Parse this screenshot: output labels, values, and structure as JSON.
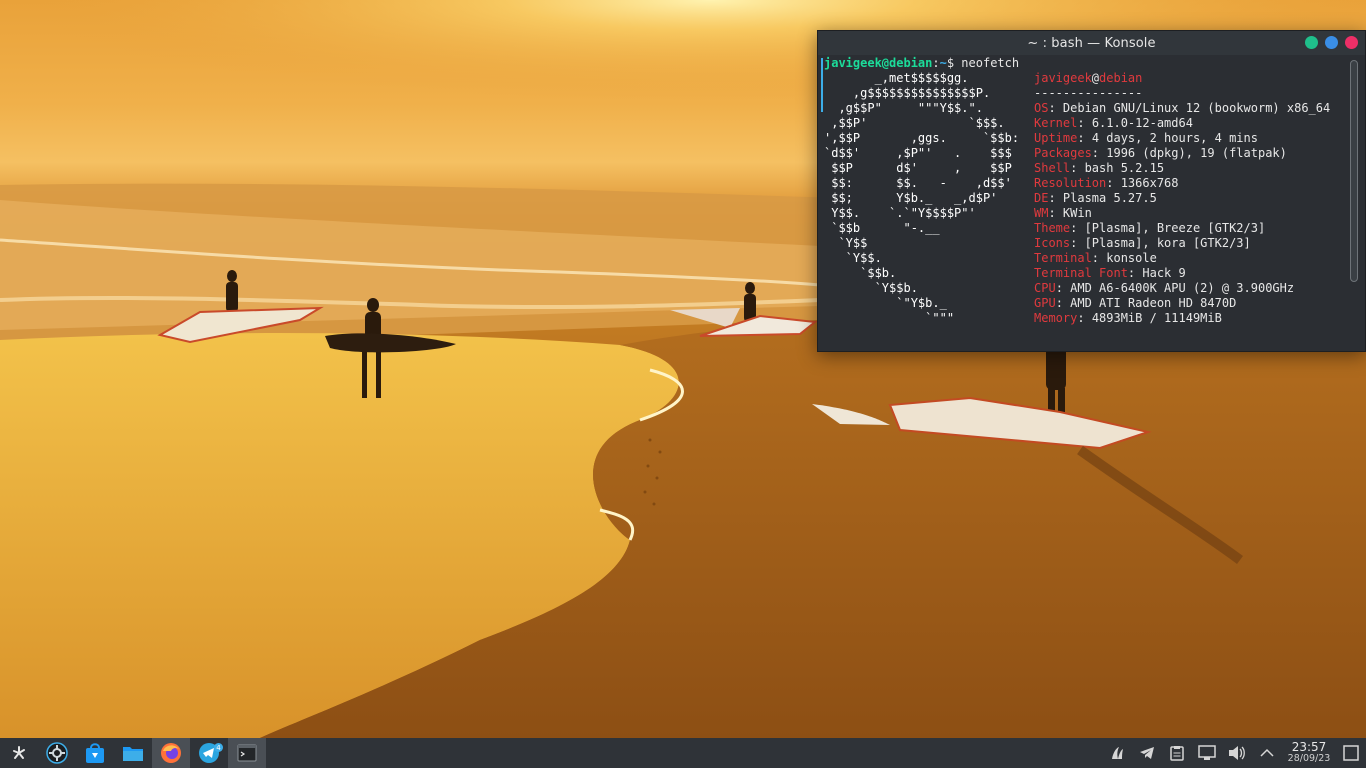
{
  "window": {
    "title": "~ : bash — Konsole"
  },
  "terminal": {
    "prompt_user": "javigeek@debian",
    "prompt_sep": ":",
    "prompt_path": "~",
    "prompt_dollar": "$ ",
    "command": "neofetch",
    "ascii_lines": [
      "       _,met$$$$$gg.",
      "    ,g$$$$$$$$$$$$$$$P.",
      "  ,g$$P\"     \"\"\"Y$$.\".",
      " ,$$P'              `$$$.",
      "',$$P       ,ggs.     `$$b:",
      "`d$$'     ,$P\"'   .    $$$",
      " $$P      d$'     ,    $$P",
      " $$:      $$.   -    ,d$$'",
      " $$;      Y$b._   _,d$P'",
      " Y$$.    `.`\"Y$$$$P\"'",
      " `$$b      \"-.__",
      "  `Y$$",
      "   `Y$$.",
      "     `$$b.",
      "       `Y$$b.",
      "          `\"Y$b._",
      "              `\"\"\""
    ],
    "header_user": "javigeek",
    "header_at": "@",
    "header_host": "debian",
    "separator": "---------------",
    "info": [
      {
        "key": "OS",
        "value": "Debian GNU/Linux 12 (bookworm) x86_64"
      },
      {
        "key": "Kernel",
        "value": "6.1.0-12-amd64"
      },
      {
        "key": "Uptime",
        "value": "4 days, 2 hours, 4 mins"
      },
      {
        "key": "Packages",
        "value": "1996 (dpkg), 19 (flatpak)"
      },
      {
        "key": "Shell",
        "value": "bash 5.2.15"
      },
      {
        "key": "Resolution",
        "value": "1366x768"
      },
      {
        "key": "DE",
        "value": "Plasma 5.27.5"
      },
      {
        "key": "WM",
        "value": "KWin"
      },
      {
        "key": "Theme",
        "value": "[Plasma], Breeze [GTK2/3]"
      },
      {
        "key": "Icons",
        "value": "[Plasma], kora [GTK2/3]"
      },
      {
        "key": "Terminal",
        "value": "konsole"
      },
      {
        "key": "Terminal Font",
        "value": "Hack 9"
      },
      {
        "key": "CPU",
        "value": "AMD A6-6400K APU (2) @ 3.900GHz"
      },
      {
        "key": "GPU",
        "value": "AMD ATI Radeon HD 8470D"
      },
      {
        "key": "Memory",
        "value": "4893MiB / 11149MiB"
      }
    ]
  },
  "taskbar": {
    "launchers": [
      {
        "name": "application-launcher",
        "icon": "kde-launcher-icon"
      },
      {
        "name": "system-settings",
        "icon": "settings-wheel-icon"
      },
      {
        "name": "discover",
        "icon": "discover-bag-icon"
      },
      {
        "name": "dolphin",
        "icon": "folder-icon"
      },
      {
        "name": "firefox",
        "icon": "firefox-icon"
      },
      {
        "name": "telegram",
        "icon": "telegram-icon",
        "badge": "4"
      },
      {
        "name": "konsole",
        "icon": "terminal-icon"
      }
    ],
    "tray": [
      "kdeconnect-icon",
      "telegram-tray-icon",
      "clipboard-icon",
      "network-icon",
      "volume-icon",
      "chevron-up-icon"
    ],
    "clock": {
      "time": "23:57",
      "date": "28/09/23"
    },
    "show_desktop_icon": "show-desktop-icon"
  },
  "colors": {
    "accent": "#3daee9",
    "prompt_user": "#1cdc9a",
    "debian_red": "#e03a3e",
    "panel": "#2f3338"
  }
}
